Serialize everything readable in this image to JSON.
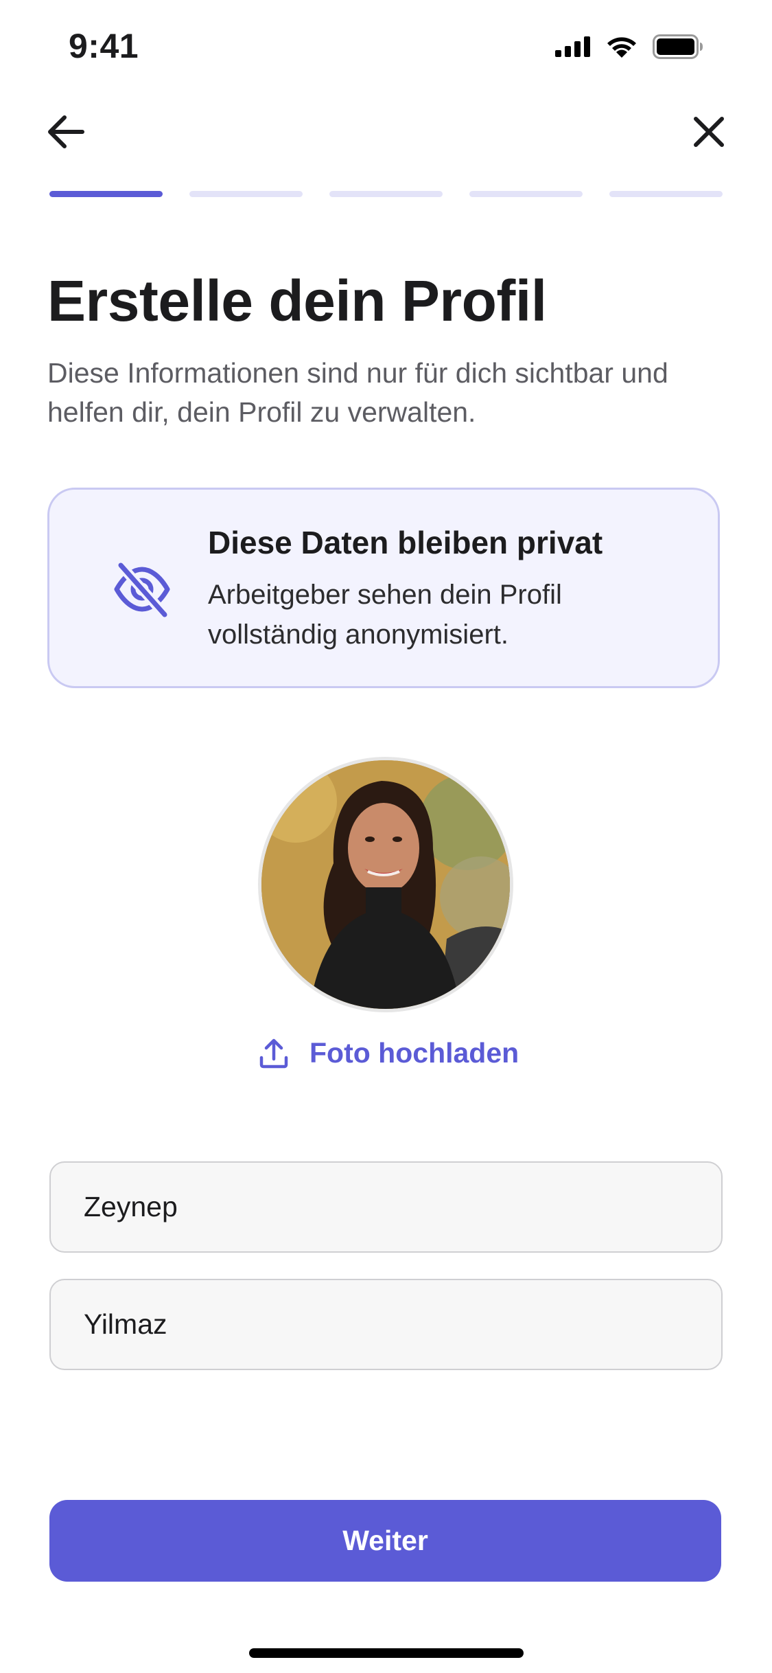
{
  "status_bar": {
    "time": "9:41",
    "icons": [
      "cellular-signal-icon",
      "wifi-icon",
      "battery-icon"
    ]
  },
  "nav": {
    "back_icon": "arrow-left-icon",
    "close_icon": "close-icon"
  },
  "progress": {
    "total_steps": 5,
    "current_step": 1
  },
  "header": {
    "title": "Erstelle dein Profil",
    "subtitle": "Diese Informationen sind nur für dich sichtbar und helfen dir, dein Profil zu verwalten."
  },
  "privacy_card": {
    "icon": "eye-off-icon",
    "title": "Diese Daten bleiben privat",
    "body": "Arbeitgeber sehen dein Profil vollständig anonymisiert."
  },
  "photo": {
    "upload_icon": "upload-icon",
    "upload_label": "Foto hochladen"
  },
  "form": {
    "first_name": "Zeynep",
    "last_name": "Yilmaz"
  },
  "actions": {
    "continue_label": "Weiter"
  },
  "colors": {
    "accent": "#5b5bd6",
    "progress_inactive": "#e3e3f8",
    "card_background": "#f3f3fe",
    "card_border": "#c9c9f2"
  }
}
